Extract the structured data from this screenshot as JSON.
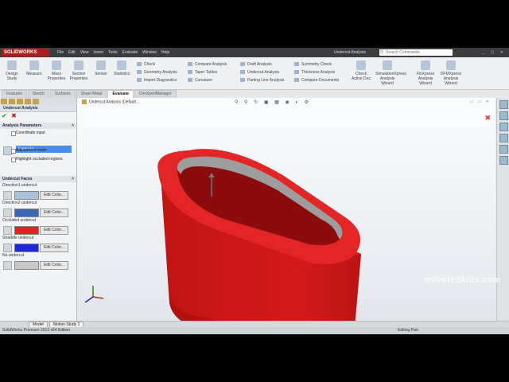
{
  "app": {
    "logo": "SOLIDWORKS",
    "menus": [
      "File",
      "Edit",
      "View",
      "Insert",
      "Tools",
      "Evaluate",
      "Window",
      "Help"
    ],
    "document_title": "Undercut Analysis",
    "search_placeholder": "Search Commands"
  },
  "ribbon": {
    "left_buttons": [
      "Design Study",
      "Measure",
      "Mass Properties",
      "Section Properties",
      "Sensor",
      "Statistics"
    ],
    "col1": [
      "Check",
      "Geometry Analysis",
      "Import Diagnostics"
    ],
    "col2": [
      "Compare Analysis",
      "Taper Tables",
      "Curvature"
    ],
    "col3": [
      "Draft Analysis",
      "Undercut Analysis",
      "Parting Line Analysis"
    ],
    "col4": [
      "Symmetry Check",
      "Thickness Analysis",
      "Compare Documents"
    ],
    "right_buttons": [
      "Check Active Doc",
      "SimulationXpress Analysis Wizard",
      "FloXpress Analysis Wizard",
      "DFMXpress Analysis Wizard"
    ],
    "tabs": [
      "Features",
      "Sketch",
      "Surfaces",
      "Sheet Metal",
      "Evaluate",
      "DimXpertManager"
    ],
    "active_tab": "Evaluate"
  },
  "panel": {
    "title": "Undercut Analysis",
    "analysis_section": "Analysis Parameters",
    "coordinate_input": "Coordinate input",
    "selected_face": "Face<1>",
    "adjustment_mode": "Adjustment mode",
    "highlight": "Highlight occluded regions",
    "faces_section": "Undercut Faces",
    "face_rows": [
      {
        "label": "Direction1 undercut",
        "color": "#a9c2dc",
        "button": "Edit Color..."
      },
      {
        "label": "Direction2 undercut",
        "color": "#3b66b4",
        "button": "Edit Color..."
      },
      {
        "label": "Occluded undercut",
        "color": "#e32222",
        "button": "Edit Color..."
      },
      {
        "label": "Straddle undercut",
        "color": "#1b2bd8",
        "button": "Edit Color..."
      },
      {
        "label": "No undercut",
        "color": "#c8c8c8",
        "button": "Edit Color..."
      }
    ]
  },
  "viewport": {
    "tree_label": "Undercut Analysis (Default..."
  },
  "bottom": {
    "tabs": [
      "Model",
      "Motion Study 1"
    ],
    "status_left": "SolidWorks Premium 2013 x64 Edition",
    "status_right": "Editing Part"
  },
  "watermark": "InfiniteSkills.com"
}
